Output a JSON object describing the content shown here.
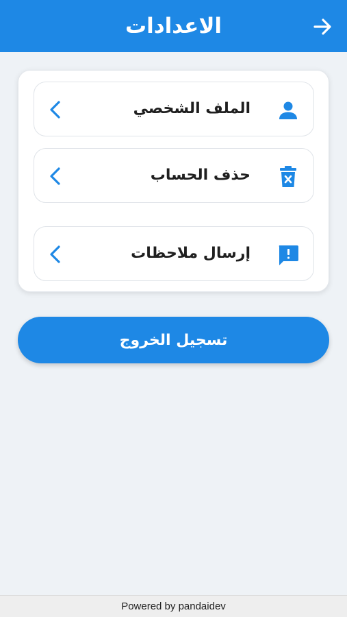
{
  "appbar": {
    "title": "الاعدادات",
    "back_icon": "arrow-right-icon"
  },
  "settings": {
    "items": [
      {
        "label": "الملف الشخصي",
        "icon": "person-icon",
        "chevron": "chevron-left-icon"
      },
      {
        "label": "حذف الحساب",
        "icon": "delete-bin-icon",
        "chevron": "chevron-left-icon"
      },
      {
        "label": "إرسال ملاحظات",
        "icon": "feedback-icon",
        "chevron": "chevron-left-icon"
      }
    ]
  },
  "logout": {
    "label": "تسجيل الخروج"
  },
  "footer": {
    "text": "Powered by pandaidev"
  },
  "colors": {
    "primary": "#1e88e5",
    "background": "#eef2f6",
    "card": "#ffffff",
    "text": "#1f1f1f"
  }
}
